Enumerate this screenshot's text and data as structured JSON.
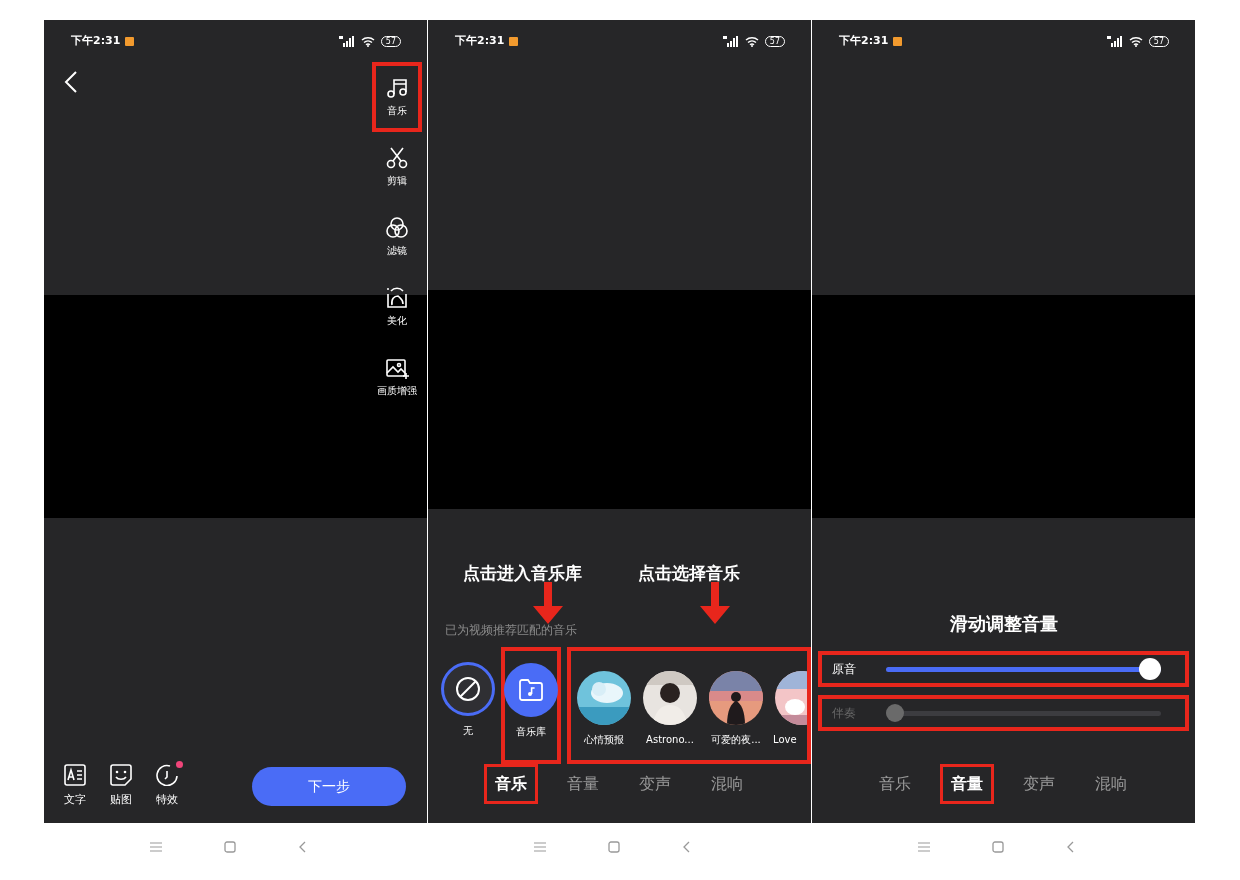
{
  "panels": [
    {
      "kind": "editor",
      "status": {
        "time": "下午2:31",
        "battery": "57"
      },
      "tools": [
        {
          "kind": "music",
          "label": "音乐",
          "highlighted": true
        },
        {
          "kind": "cut",
          "label": "剪辑",
          "highlighted": false
        },
        {
          "kind": "filter",
          "label": "滤镜",
          "highlighted": false
        },
        {
          "kind": "beauty",
          "label": "美化",
          "highlighted": false
        },
        {
          "kind": "enhance",
          "label": "画质增强",
          "highlighted": false
        }
      ],
      "bottom_tools": [
        {
          "kind": "text",
          "label": "文字",
          "badge": false
        },
        {
          "kind": "sticker",
          "label": "贴图",
          "badge": false
        },
        {
          "kind": "effect",
          "label": "特效",
          "badge": true
        }
      ],
      "next_button": "下一步"
    },
    {
      "kind": "music",
      "status": {
        "time": "下午2:31",
        "battery": "57"
      },
      "annotations": [
        "点击进入音乐库",
        "点击选择音乐"
      ],
      "subtitle": "已为视频推荐匹配的音乐",
      "none_option": {
        "label": "无",
        "selected": true
      },
      "library": {
        "label": "音乐库",
        "highlighted": true
      },
      "tracks": {
        "highlighted": true,
        "items": [
          {
            "label": "心情预报"
          },
          {
            "label": "Astrono..."
          },
          {
            "label": "可爱的夜..."
          },
          {
            "label": "Love"
          }
        ]
      },
      "tabs": [
        {
          "label": "音乐",
          "selected": true,
          "highlighted": true
        },
        {
          "label": "音量",
          "selected": false,
          "highlighted": false
        },
        {
          "label": "变声",
          "selected": false,
          "highlighted": false
        },
        {
          "label": "混响",
          "selected": false,
          "highlighted": false
        }
      ]
    },
    {
      "kind": "volume",
      "status": {
        "time": "下午2:31",
        "battery": "57"
      },
      "title": "滑动调整音量",
      "sliders": [
        {
          "label": "原音",
          "level": 1,
          "disabled": false,
          "highlighted": true
        },
        {
          "label": "伴奏",
          "level": 0,
          "disabled": true,
          "highlighted": true
        }
      ],
      "tabs": [
        {
          "label": "音乐",
          "selected": false,
          "highlighted": false
        },
        {
          "label": "音量",
          "selected": true,
          "highlighted": true
        },
        {
          "label": "变声",
          "selected": false,
          "highlighted": false
        },
        {
          "label": "混响",
          "selected": false,
          "highlighted": false
        }
      ]
    }
  ]
}
